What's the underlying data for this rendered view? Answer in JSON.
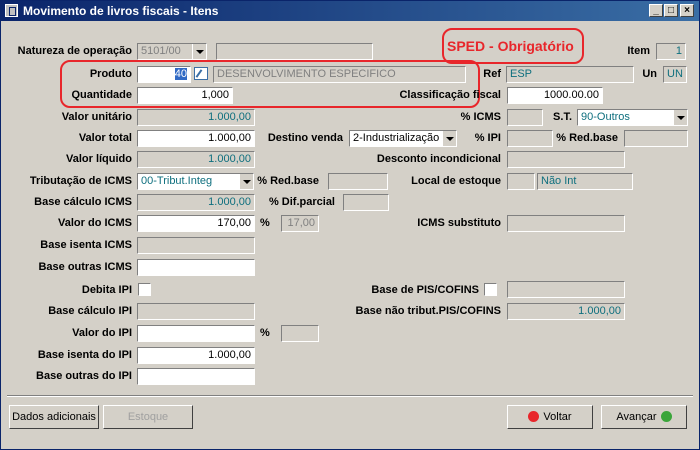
{
  "window": {
    "title": "Movimento de livros fiscais - Itens"
  },
  "annotation": {
    "text": "SPED - Obrigatório"
  },
  "fields": {
    "natureza_label": "Natureza de operação",
    "natureza_value": "5101/00",
    "item_label": "Item",
    "item_value": "1",
    "produto_label": "Produto",
    "produto_code": "40",
    "produto_desc": "DESENVOLVIMENTO ESPECIFICO",
    "ref_label": "Ref",
    "ref_value": "ESP",
    "un_label": "Un",
    "un_value": "UN",
    "quantidade_label": "Quantidade",
    "quantidade_value": "1,000",
    "classificacao_label": "Classificação fiscal",
    "classificacao_value": "1000.00.00",
    "valor_unitario_label": "Valor unitário",
    "valor_unitario_value": "1.000,00",
    "icms_pct_label": "% ICMS",
    "st_label": "S.T.",
    "st_value": "90-Outros",
    "valor_total_label": "Valor total",
    "valor_total_value": "1.000,00",
    "destino_label": "Destino venda",
    "destino_value": "2-Industrialização",
    "ipi_pct_label": "% IPI",
    "redbase_label": "% Red.base",
    "valor_liquido_label": "Valor líquido",
    "valor_liquido_value": "1.000,00",
    "desconto_label": "Desconto incondicional",
    "tributacao_label": "Tributação de ICMS",
    "tributacao_value": "00-Tribut.Integ",
    "redbase2_label": "% Red.base",
    "local_estoque_label": "Local de estoque",
    "local_estoque_value": "Não Int",
    "base_calc_icms_label": "Base cálculo ICMS",
    "base_calc_icms_value": "1.000,00",
    "dif_parcial_label": "% Dif.parcial",
    "valor_icms_label": "Valor do ICMS",
    "valor_icms_value": "170,00",
    "pct_label": "%",
    "pct_value": "17,00",
    "icms_sub_label": "ICMS substituto",
    "base_isenta_icms_label": "Base isenta ICMS",
    "base_outras_icms_label": "Base outras ICMS",
    "debita_ipi_label": "Debita IPI",
    "base_pis_label": "Base de PIS/COFINS",
    "base_calc_ipi_label": "Base cálculo IPI",
    "base_nao_trib_label": "Base não tribut.PIS/COFINS",
    "base_nao_trib_value": "1.000,00",
    "valor_ipi_label": "Valor do IPI",
    "pct2_label": "%",
    "base_isenta_ipi_label": "Base isenta do IPI",
    "base_isenta_ipi_value": "1.000,00",
    "base_outras_ipi_label": "Base outras do IPI"
  },
  "buttons": {
    "dados": "Dados adicionais",
    "estoque": "Estoque",
    "voltar": "Voltar",
    "avancar": "Avançar"
  },
  "colors": {
    "accent_red": "#e8262b",
    "title_bar": "#0a246a",
    "teal_text": "#0e6f7e"
  }
}
